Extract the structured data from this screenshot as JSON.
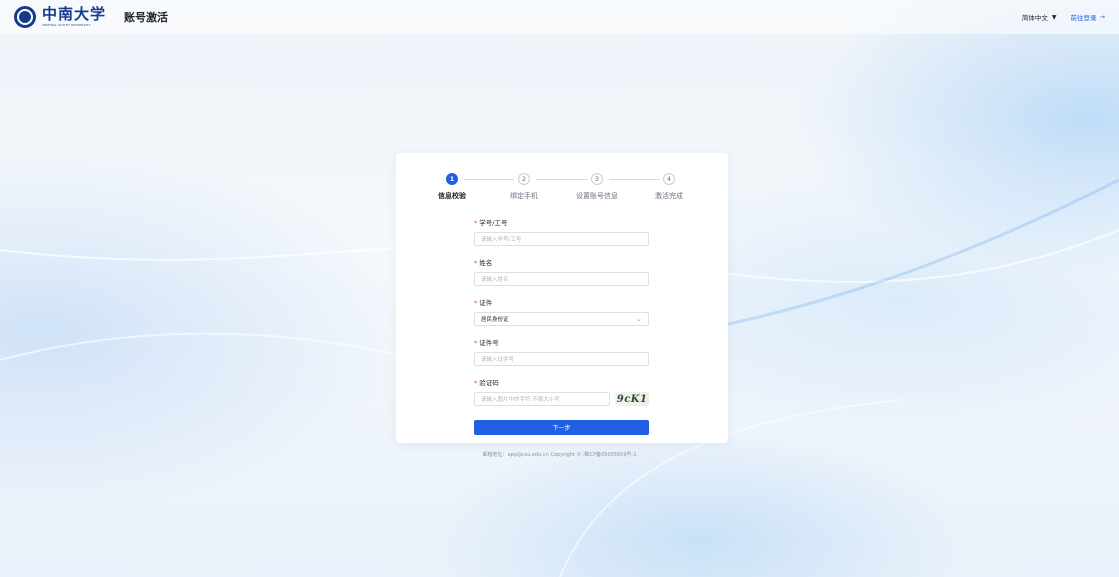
{
  "header": {
    "logo_cn": "中南大学",
    "logo_en": "CENTRAL SOUTH UNIVERSITY",
    "page_title": "账号激活",
    "language": "简体中文",
    "login_link": "前往登录",
    "login_arrow": "→",
    "caret": "▼"
  },
  "steps": [
    {
      "number": "1",
      "label": "信息校验",
      "active": true
    },
    {
      "number": "2",
      "label": "绑定手机",
      "active": false
    },
    {
      "number": "3",
      "label": "设置账号信息",
      "active": false
    },
    {
      "number": "4",
      "label": "激活完成",
      "active": false
    }
  ],
  "form": {
    "required_mark": "*",
    "student_id": {
      "label": "学号/工号",
      "placeholder": "请输入学号/工号"
    },
    "name": {
      "label": "姓名",
      "placeholder": "请输入姓名"
    },
    "id_type": {
      "label": "证件",
      "value": "居民身份证",
      "chevron": "⌄"
    },
    "id_number": {
      "label": "证件号",
      "placeholder": "请输入证件号"
    },
    "captcha": {
      "label": "验证码",
      "placeholder": "请输入图片中的字符,不限大小写",
      "image_text": "9cK1"
    },
    "next_button": "下一步"
  },
  "footer": {
    "text": "邮箱地址：app@csu.edu.cn Copyright © 湘ICP备05005659号-1"
  },
  "colors": {
    "primary": "#1f5fe0",
    "brand": "#163a8c",
    "required": "#e5484d"
  }
}
